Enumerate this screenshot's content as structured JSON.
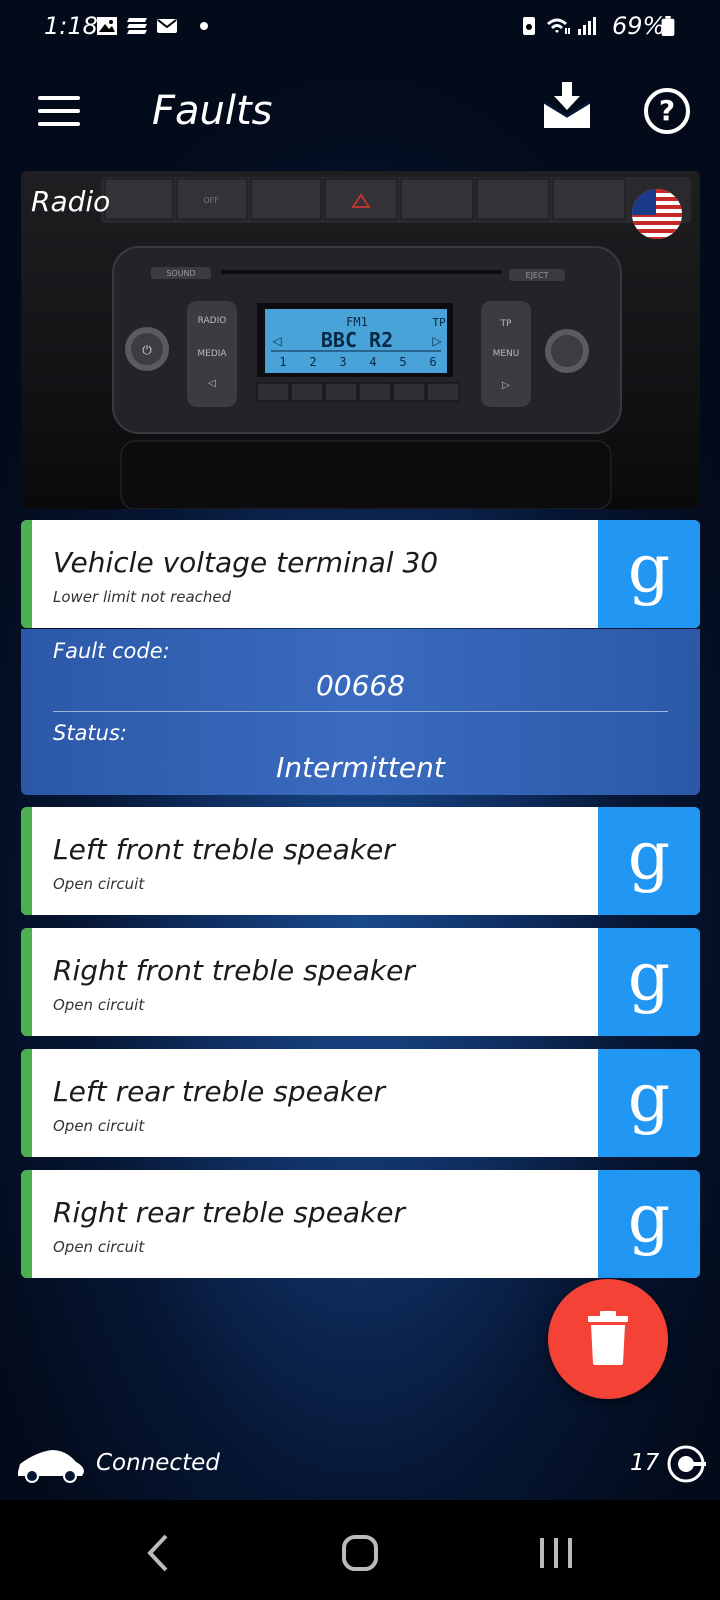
{
  "status_bar": {
    "time": "1:18",
    "battery": "69%"
  },
  "header": {
    "title": "Faults"
  },
  "hero": {
    "label": "Radio",
    "radio_display": {
      "band": "FM1",
      "station": "BBC R2",
      "tp": "TP",
      "presets": [
        "1",
        "2",
        "3",
        "4",
        "5",
        "6"
      ]
    },
    "radio_buttons": {
      "radio": "RADIO",
      "media": "MEDIA",
      "tp": "TP",
      "menu": "MENU",
      "sound": "SOUND",
      "eject": "EJECT",
      "off": "OFF"
    }
  },
  "faults": [
    {
      "title": "Vehicle voltage terminal 30",
      "subtitle": "Lower limit not reached",
      "search": "g"
    },
    {
      "title": "Left front treble speaker",
      "subtitle": "Open circuit",
      "search": "g"
    },
    {
      "title": "Right front treble speaker",
      "subtitle": "Open circuit",
      "search": "g"
    },
    {
      "title": "Left rear treble speaker",
      "subtitle": "Open circuit",
      "search": "g"
    },
    {
      "title": "Right rear treble speaker",
      "subtitle": "Open circuit",
      "search": "g"
    }
  ],
  "detail": {
    "fault_code_label": "Fault code:",
    "fault_code": "00668",
    "status_label": "Status:",
    "status": "Intermittent"
  },
  "footer": {
    "connection": "Connected",
    "count": "17"
  },
  "colors": {
    "accent_green": "#4caf50",
    "google_blue": "#2196f3",
    "fab_red": "#f44336"
  }
}
